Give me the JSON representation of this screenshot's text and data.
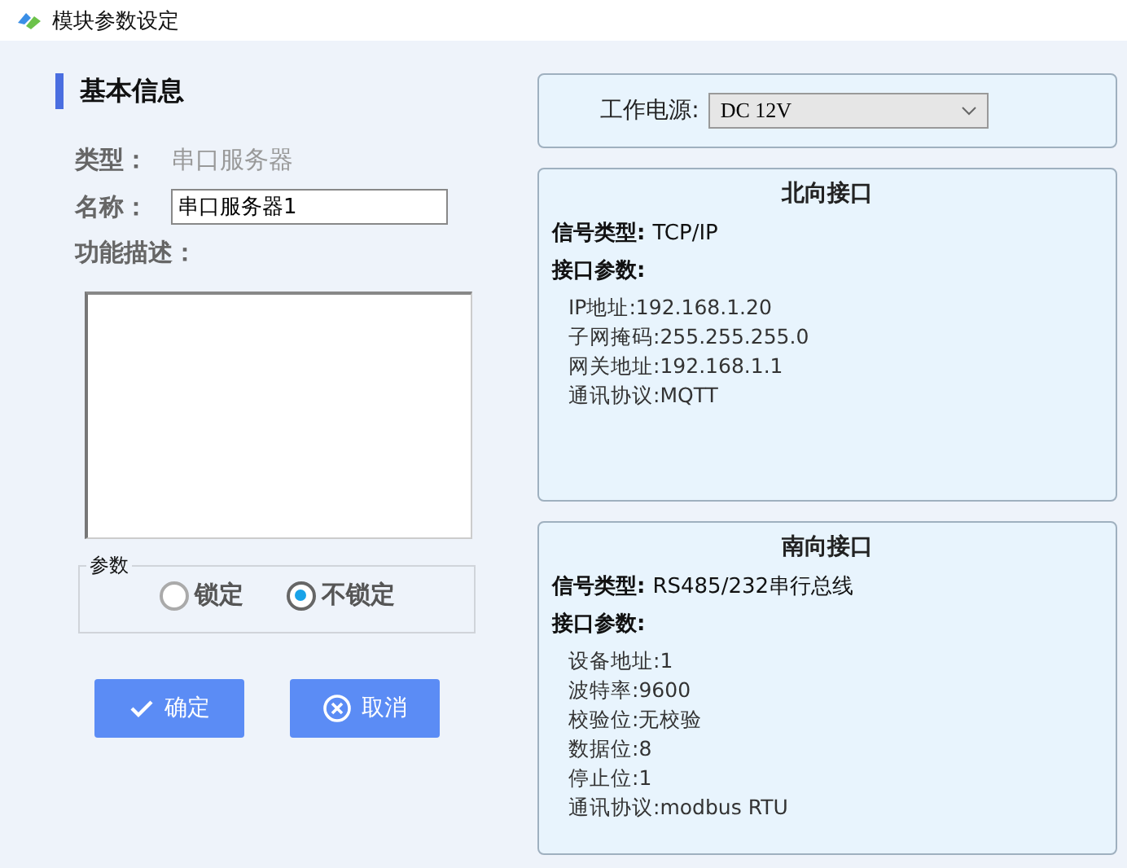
{
  "window": {
    "title": "模块参数设定"
  },
  "basic": {
    "heading": "基本信息",
    "type_label": "类型：",
    "type_value": "串口服务器",
    "name_label": "名称：",
    "name_value": "串口服务器1",
    "desc_label": "功能描述："
  },
  "params": {
    "legend": "参数",
    "options": [
      {
        "label": "锁定",
        "selected": false
      },
      {
        "label": "不锁定",
        "selected": true
      }
    ]
  },
  "buttons": [
    {
      "kind": "ok",
      "label": "确定"
    },
    {
      "kind": "cancel",
      "label": "取消"
    }
  ],
  "power": {
    "label": "工作电源:",
    "value": "DC 12V"
  },
  "interfaces": [
    {
      "title": "北向接口",
      "signal_label": "信号类型:",
      "signal_value": "TCP/IP",
      "params_label": "接口参数:",
      "params": [
        "IP地址:192.168.1.20",
        "子网掩码:255.255.255.0",
        "网关地址:192.168.1.1",
        "通讯协议:MQTT"
      ]
    },
    {
      "title": "南向接口",
      "signal_label": "信号类型:",
      "signal_value": "RS485/232串行总线",
      "params_label": "接口参数:",
      "params": [
        "设备地址:1",
        "波特率:9600",
        "校验位:无校验",
        "数据位:8",
        "停止位:1",
        "通讯协议:modbus RTU"
      ]
    }
  ]
}
